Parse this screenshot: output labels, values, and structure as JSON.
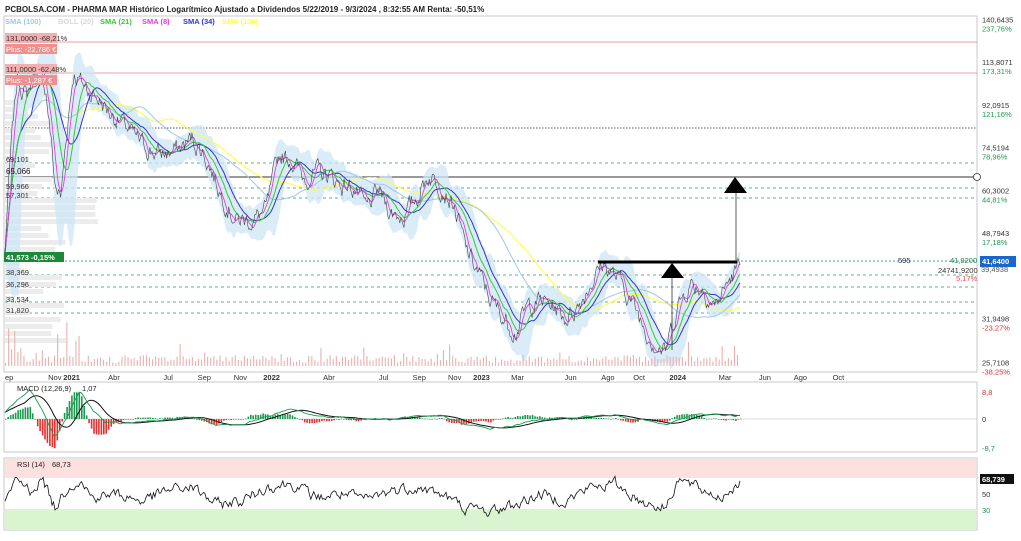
{
  "header": {
    "title": "PCBOLSA.COM - PHARMA MAR Histórico Logarítmico Ajustado a Dividendos 5/22/2019 - 9/3/2024 , 8:32:55 AM Renta: -50,51%"
  },
  "legend": [
    {
      "label": "SMA (100)",
      "color": "#9ec8e8"
    },
    {
      "label": "BOLL (20)",
      "color": "#d8d8d8"
    },
    {
      "label": "SMA (21)",
      "color": "#33cc33"
    },
    {
      "label": "SMA (8)",
      "color": "#e040e0"
    },
    {
      "label": "SMA (34)",
      "color": "#3333cc"
    },
    {
      "label": "SMA (134)",
      "color": "#ffff33"
    }
  ],
  "colors": {
    "red_line": "#e08080",
    "green_dash": "#2a9a6a",
    "price_tag": "#1a66cc",
    "macd_green": "#1a9a50",
    "macd_red": "#e03030",
    "rsi_top_zone": "#fde0e0",
    "rsi_bottom_zone": "#d8f5d0",
    "current_tag_green": "#1a8a3a"
  },
  "chart_data": [
    {
      "type": "line",
      "panel": "price",
      "scale": "log",
      "ylim": [
        24.5,
        143
      ],
      "x_ticks": [
        "ep",
        "Nov",
        "2021",
        "Abr",
        "Jul",
        "Sep",
        "Nov",
        "2022",
        "Abr",
        "Jul",
        "Sep",
        "Nov",
        "2023",
        "Mar",
        "Jun",
        "Ago",
        "Oct",
        "2024",
        "Mar",
        "Jun",
        "Ago",
        "Oct"
      ],
      "x_ticks_bold": [
        "2021",
        "2022",
        "2023",
        "2024"
      ],
      "right_axis": [
        {
          "value": "140,6435",
          "pct": "237,76%"
        },
        {
          "value": "113,8071",
          "pct": "173,31%"
        },
        {
          "value": "92,0915",
          "pct": "121,16%"
        },
        {
          "value": "74,5194",
          "pct": "78,96%"
        },
        {
          "value": "60,3002",
          "pct": "44,81%"
        },
        {
          "value": "48,7943",
          "pct": "17,18%"
        },
        {
          "value": "31,9498",
          "pct": "-23,27%"
        },
        {
          "value": "25,7108",
          "pct": "-38,25%"
        }
      ],
      "right_misc": {
        "pct_near_current": "5,17%",
        "val_near_current": "39,4938"
      },
      "left_levels": [
        "69,101",
        "65,066",
        "59,966",
        "57,301",
        "38,369",
        "36,296",
        "33,534",
        "31,820"
      ],
      "left_boxes": [
        {
          "line1": "131,0000 -68,21%",
          "line2": "Plus: -22,786 €"
        },
        {
          "line1": "111,0000 -62,48%",
          "line2": "Plus: -1,287 €"
        }
      ],
      "current_tag_left": "41,573 -0,15%",
      "current_tag_right": "41,6400",
      "resistance_value": "41,9200",
      "resistance_count": "595",
      "volume_label": "24741,9200",
      "anchors": [
        {
          "t": 0.0,
          "v": 44
        },
        {
          "t": 0.02,
          "v": 105
        },
        {
          "t": 0.035,
          "v": 96
        },
        {
          "t": 0.05,
          "v": 112
        },
        {
          "t": 0.065,
          "v": 100
        },
        {
          "t": 0.08,
          "v": 62
        },
        {
          "t": 0.09,
          "v": 58
        },
        {
          "t": 0.11,
          "v": 108
        },
        {
          "t": 0.13,
          "v": 100
        },
        {
          "t": 0.15,
          "v": 95
        },
        {
          "t": 0.17,
          "v": 88
        },
        {
          "t": 0.19,
          "v": 84
        },
        {
          "t": 0.21,
          "v": 78
        },
        {
          "t": 0.23,
          "v": 74
        },
        {
          "t": 0.25,
          "v": 72
        },
        {
          "t": 0.28,
          "v": 74
        },
        {
          "t": 0.3,
          "v": 78
        },
        {
          "t": 0.32,
          "v": 72
        },
        {
          "t": 0.345,
          "v": 60
        },
        {
          "t": 0.37,
          "v": 52
        },
        {
          "t": 0.4,
          "v": 52
        },
        {
          "t": 0.42,
          "v": 55
        },
        {
          "t": 0.44,
          "v": 72
        },
        {
          "t": 0.46,
          "v": 70
        },
        {
          "t": 0.48,
          "v": 64
        },
        {
          "t": 0.5,
          "v": 66
        },
        {
          "t": 0.52,
          "v": 65
        },
        {
          "t": 0.54,
          "v": 62
        },
        {
          "t": 0.56,
          "v": 61
        },
        {
          "t": 0.58,
          "v": 55
        },
        {
          "t": 0.6,
          "v": 60
        },
        {
          "t": 0.62,
          "v": 54
        },
        {
          "t": 0.64,
          "v": 53
        },
        {
          "t": 0.66,
          "v": 58
        },
        {
          "t": 0.68,
          "v": 65
        },
        {
          "t": 0.7,
          "v": 62
        },
        {
          "t": 0.72,
          "v": 56
        },
        {
          "t": 0.74,
          "v": 45
        },
        {
          "t": 0.76,
          "v": 40
        },
        {
          "t": 0.78,
          "v": 35
        },
        {
          "t": 0.8,
          "v": 32
        },
        {
          "t": 0.82,
          "v": 30
        },
        {
          "t": 0.84,
          "v": 34
        },
        {
          "t": 0.86,
          "v": 35
        },
        {
          "t": 0.88,
          "v": 34
        },
        {
          "t": 0.9,
          "v": 32
        },
        {
          "t": 0.92,
          "v": 34
        },
        {
          "t": 0.94,
          "v": 38
        },
        {
          "t": 0.96,
          "v": 42
        },
        {
          "t": 0.975,
          "v": 40
        },
        {
          "t": 0.99,
          "v": 38
        },
        {
          "t": 1.01,
          "v": 34
        },
        {
          "t": 1.03,
          "v": 30
        },
        {
          "t": 1.045,
          "v": 28
        },
        {
          "t": 1.06,
          "v": 27
        },
        {
          "t": 1.08,
          "v": 34
        },
        {
          "t": 1.1,
          "v": 38
        },
        {
          "t": 1.12,
          "v": 37
        },
        {
          "t": 1.14,
          "v": 34
        },
        {
          "t": 1.16,
          "v": 38
        },
        {
          "t": 1.18,
          "v": 41.64
        }
      ]
    },
    {
      "type": "line",
      "panel": "macd",
      "title": "MACD (12,26,9)",
      "value": "1,07",
      "ylim": [
        -10,
        10
      ],
      "right_axis": [
        "8,8",
        "0",
        "-8,7"
      ],
      "anchors": [
        {
          "t": 0.0,
          "v": 2
        },
        {
          "t": 0.02,
          "v": 6
        },
        {
          "t": 0.04,
          "v": 9
        },
        {
          "t": 0.06,
          "v": 3
        },
        {
          "t": 0.08,
          "v": -6
        },
        {
          "t": 0.1,
          "v": 1
        },
        {
          "t": 0.12,
          "v": 9
        },
        {
          "t": 0.14,
          "v": 3
        },
        {
          "t": 0.16,
          "v": -1
        },
        {
          "t": 0.2,
          "v": -1.5
        },
        {
          "t": 0.24,
          "v": -1
        },
        {
          "t": 0.3,
          "v": 1
        },
        {
          "t": 0.34,
          "v": -2
        },
        {
          "t": 0.38,
          "v": -2
        },
        {
          "t": 0.42,
          "v": 1
        },
        {
          "t": 0.46,
          "v": 3
        },
        {
          "t": 0.5,
          "v": 1
        },
        {
          "t": 0.54,
          "v": 0.5
        },
        {
          "t": 0.58,
          "v": 0
        },
        {
          "t": 0.62,
          "v": 0
        },
        {
          "t": 0.66,
          "v": 1
        },
        {
          "t": 0.7,
          "v": 1
        },
        {
          "t": 0.74,
          "v": -2
        },
        {
          "t": 0.78,
          "v": -3
        },
        {
          "t": 0.82,
          "v": -2
        },
        {
          "t": 0.86,
          "v": 0
        },
        {
          "t": 0.9,
          "v": 0
        },
        {
          "t": 0.94,
          "v": 1
        },
        {
          "t": 0.98,
          "v": 1
        },
        {
          "t": 1.02,
          "v": 0
        },
        {
          "t": 1.06,
          "v": -2
        },
        {
          "t": 1.1,
          "v": 1
        },
        {
          "t": 1.14,
          "v": 1.5
        },
        {
          "t": 1.18,
          "v": 1.07
        }
      ]
    },
    {
      "type": "line",
      "panel": "rsi",
      "title": "RSI (14)",
      "value": "68,73",
      "ylim": [
        0,
        100
      ],
      "right_axis": [
        "68,739",
        "50",
        "30"
      ],
      "anchors": [
        {
          "t": 0.0,
          "v": 40
        },
        {
          "t": 0.02,
          "v": 70
        },
        {
          "t": 0.04,
          "v": 55
        },
        {
          "t": 0.06,
          "v": 72
        },
        {
          "t": 0.08,
          "v": 30
        },
        {
          "t": 0.1,
          "v": 60
        },
        {
          "t": 0.12,
          "v": 70
        },
        {
          "t": 0.14,
          "v": 45
        },
        {
          "t": 0.18,
          "v": 50
        },
        {
          "t": 0.22,
          "v": 40
        },
        {
          "t": 0.26,
          "v": 55
        },
        {
          "t": 0.3,
          "v": 60
        },
        {
          "t": 0.34,
          "v": 35
        },
        {
          "t": 0.38,
          "v": 40
        },
        {
          "t": 0.42,
          "v": 60
        },
        {
          "t": 0.46,
          "v": 65
        },
        {
          "t": 0.5,
          "v": 45
        },
        {
          "t": 0.54,
          "v": 50
        },
        {
          "t": 0.58,
          "v": 42
        },
        {
          "t": 0.62,
          "v": 55
        },
        {
          "t": 0.66,
          "v": 60
        },
        {
          "t": 0.7,
          "v": 50
        },
        {
          "t": 0.74,
          "v": 30
        },
        {
          "t": 0.78,
          "v": 25
        },
        {
          "t": 0.82,
          "v": 35
        },
        {
          "t": 0.86,
          "v": 50
        },
        {
          "t": 0.9,
          "v": 40
        },
        {
          "t": 0.94,
          "v": 60
        },
        {
          "t": 0.98,
          "v": 65
        },
        {
          "t": 1.02,
          "v": 40
        },
        {
          "t": 1.06,
          "v": 30
        },
        {
          "t": 1.08,
          "v": 72
        },
        {
          "t": 1.12,
          "v": 55
        },
        {
          "t": 1.15,
          "v": 45
        },
        {
          "t": 1.18,
          "v": 68.73
        }
      ]
    }
  ]
}
